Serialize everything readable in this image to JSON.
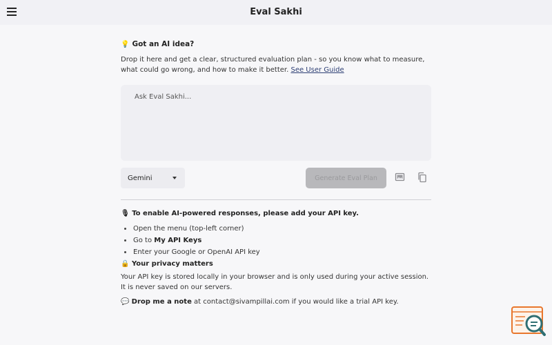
{
  "header": {
    "title": "Eval Sakhi"
  },
  "intro": {
    "heading": "Got an AI idea?",
    "text_before_link": "Drop it here and get a clear, structured evaluation plan - so you know what to measure, what could go wrong, and how to make it better. ",
    "link_label": "See User Guide"
  },
  "prompt": {
    "placeholder": "Ask Eval Sakhi..."
  },
  "controls": {
    "model_selected": "Gemini",
    "generate_label": "Generate Eval Plan",
    "generate_enabled": false
  },
  "api_notice": {
    "heading": "To enable AI-powered responses, please add your API key.",
    "steps": [
      {
        "text_before": "Open the menu (top-left corner)",
        "bold": ""
      },
      {
        "text_before": "Go to ",
        "bold": "My API Keys"
      },
      {
        "text_before": "Enter your Google or OpenAI API key",
        "bold": ""
      }
    ]
  },
  "privacy": {
    "heading": "Your privacy matters",
    "text": "Your API key is stored locally in your browser and is only used during your active session. It is never saved on our servers."
  },
  "note": {
    "bold": "Drop me a note",
    "text": " at contact@sivampillai.com if you would like a trial API key."
  },
  "icons": {
    "menu": "hamburger-menu-icon",
    "bulb": "lightbulb-icon",
    "key": "key-icon",
    "lock": "lock-icon",
    "speech": "speech-bubble-icon",
    "image": "image-icon",
    "copy": "copy-icon",
    "logo": "eval-search-logo-icon"
  },
  "colors": {
    "background": "#f7f7f9",
    "header": "#f1f1f5",
    "input_bg": "#efeff3",
    "button_disabled": "#b8b8bb",
    "link": "#2c3e73",
    "logo_orange": "#e8762c",
    "logo_teal": "#2f6f73"
  }
}
